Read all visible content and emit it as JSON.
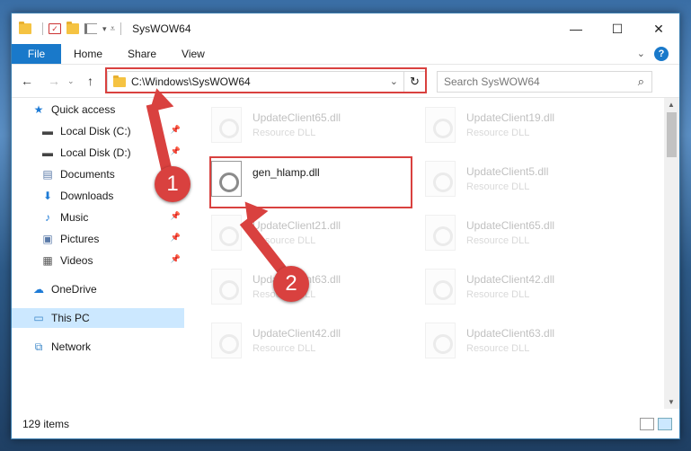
{
  "window": {
    "title": "SysWOW64",
    "controls": {
      "minimize": "—",
      "maximize": "☐",
      "close": "✕"
    }
  },
  "ribbon": {
    "tabs": [
      "File",
      "Home",
      "Share",
      "View"
    ],
    "help": "?",
    "caret": "⌄"
  },
  "address": {
    "path": "C:\\Windows\\SysWOW64",
    "chevron": "⌄",
    "refresh": "↻"
  },
  "search": {
    "placeholder": "Search SysWOW64"
  },
  "sidebar": {
    "items": [
      {
        "label": "Quick access",
        "icon": "star-icon",
        "glyph": "★",
        "color": "#1e7bd6",
        "pinned": false
      },
      {
        "label": "Local Disk (C:)",
        "icon": "drive-icon",
        "glyph": "▬",
        "color": "#444",
        "pinned": true
      },
      {
        "label": "Local Disk (D:)",
        "icon": "drive-icon",
        "glyph": "▬",
        "color": "#444",
        "pinned": true
      },
      {
        "label": "Documents",
        "icon": "documents-icon",
        "glyph": "▤",
        "color": "#5a7aa8",
        "pinned": true
      },
      {
        "label": "Downloads",
        "icon": "downloads-icon",
        "glyph": "⬇",
        "color": "#1e7bd6",
        "pinned": true
      },
      {
        "label": "Music",
        "icon": "music-icon",
        "glyph": "♪",
        "color": "#1e7bd6",
        "pinned": true
      },
      {
        "label": "Pictures",
        "icon": "pictures-icon",
        "glyph": "▣",
        "color": "#5a7aa8",
        "pinned": true
      },
      {
        "label": "Videos",
        "icon": "videos-icon",
        "glyph": "▦",
        "color": "#555",
        "pinned": true
      },
      {
        "label": "OneDrive",
        "icon": "onedrive-icon",
        "glyph": "☁",
        "color": "#1e7bd6",
        "pinned": false
      },
      {
        "label": "This PC",
        "icon": "this-pc-icon",
        "glyph": "▭",
        "color": "#3a86c8",
        "pinned": false,
        "selected": true
      },
      {
        "label": "Network",
        "icon": "network-icon",
        "glyph": "⧉",
        "color": "#3a86c8",
        "pinned": false
      }
    ]
  },
  "files": [
    {
      "name": "UpdateClient65.dll",
      "desc": "Resource DLL",
      "state": "ghost"
    },
    {
      "name": "UpdateClient19.dll",
      "desc": "Resource DLL",
      "state": "ghost"
    },
    {
      "name": "gen_hlamp.dll",
      "desc": "",
      "state": "active"
    },
    {
      "name": "UpdateClient5.dll",
      "desc": "Resource DLL",
      "state": "ghost"
    },
    {
      "name": "UpdateClient21.dll",
      "desc": "Resource DLL",
      "state": "ghost"
    },
    {
      "name": "UpdateClient65.dll",
      "desc": "Resource DLL",
      "state": "ghost"
    },
    {
      "name": "UpdateClient63.dll",
      "desc": "Resource DLL",
      "state": "ghost"
    },
    {
      "name": "UpdateClient42.dll",
      "desc": "Resource DLL",
      "state": "ghost"
    },
    {
      "name": "UpdateClient42.dll",
      "desc": "Resource DLL",
      "state": "ghost"
    },
    {
      "name": "UpdateClient63.dll",
      "desc": "Resource DLL",
      "state": "ghost"
    }
  ],
  "status": {
    "count": "129 items"
  },
  "annotations": {
    "badge1": "1",
    "badge2": "2",
    "color": "#d9413f"
  }
}
